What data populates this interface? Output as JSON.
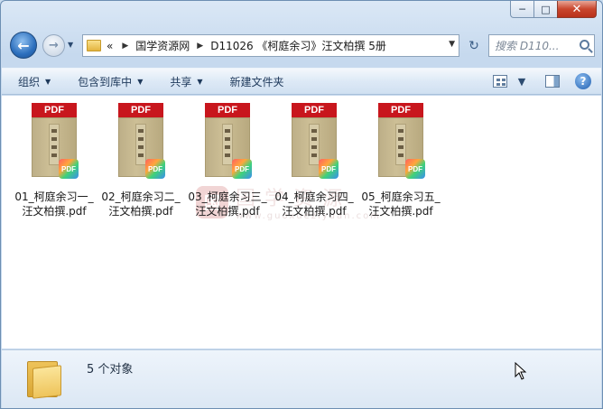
{
  "window": {
    "caption": {
      "minimize": "─",
      "maximize": "□",
      "close": "✕"
    }
  },
  "nav": {
    "back_glyph": "←",
    "forward_glyph": "→",
    "history_glyph": "▼",
    "breadcrumb": {
      "overflow": "«",
      "items": [
        "国学资源网",
        "D11026 《柯庭余习》汪文柏撰 5册"
      ]
    },
    "address_dropdown_glyph": "▼",
    "refresh_glyph": "↻",
    "search_placeholder": "搜索 D110..."
  },
  "toolbar": {
    "items": [
      {
        "label": "组织",
        "has_dropdown": true
      },
      {
        "label": "包含到库中",
        "has_dropdown": true
      },
      {
        "label": "共享",
        "has_dropdown": true
      },
      {
        "label": "新建文件夹",
        "has_dropdown": false
      }
    ],
    "views_dropdown_glyph": "▼",
    "help_glyph": "?"
  },
  "files": [
    {
      "band": "PDF",
      "badge": "PDF",
      "name_line1": "01_柯庭余习一_",
      "name_line2": "汪文柏撰.pdf"
    },
    {
      "band": "PDF",
      "badge": "PDF",
      "name_line1": "02_柯庭余习二_",
      "name_line2": "汪文柏撰.pdf"
    },
    {
      "band": "PDF",
      "badge": "PDF",
      "name_line1": "03_柯庭余习三_",
      "name_line2": "汪文柏撰.pdf"
    },
    {
      "band": "PDF",
      "badge": "PDF",
      "name_line1": "04_柯庭余习四_",
      "name_line2": "汪文柏撰.pdf"
    },
    {
      "band": "PDF",
      "badge": "PDF",
      "name_line1": "05_柯庭余习五_",
      "name_line2": "汪文柏撰.pdf"
    }
  ],
  "watermark": {
    "logo": "国",
    "title": "国学资源",
    "url": "www.guoxueziyuan.com"
  },
  "status": {
    "count_text": "5 个对象"
  },
  "colors": {
    "pdf_red": "#c8161d",
    "window_frame": "#c6d9ee",
    "close_red": "#c9462d"
  }
}
